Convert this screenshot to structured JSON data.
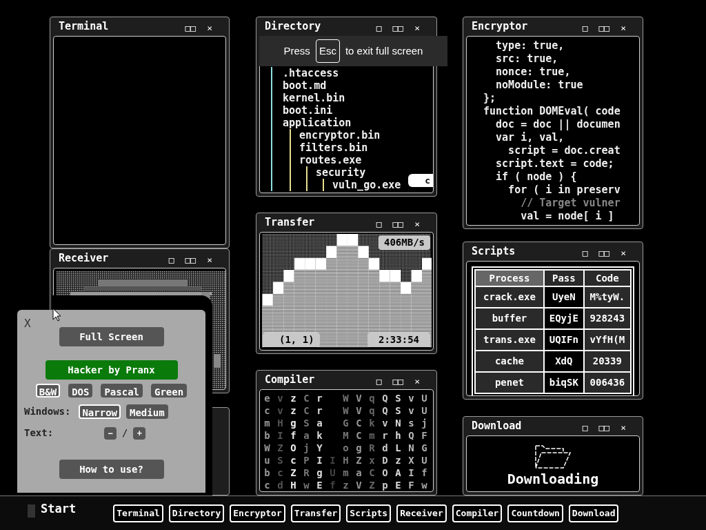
{
  "windows": [
    {
      "kind": "terminal",
      "title": "Terminal",
      "controls": [
        "□□",
        "×"
      ]
    },
    {
      "kind": "receiver",
      "title": "Receiver",
      "controls": [
        "□",
        "□□",
        "×"
      ]
    },
    {
      "kind": "directory",
      "title": "Directory",
      "controls": [
        "□",
        "□□",
        "×"
      ],
      "tree": [
        {
          "name": ".htaccess"
        },
        {
          "name": "boot.md"
        },
        {
          "name": "kernel.bin"
        },
        {
          "name": "boot.ini"
        },
        {
          "name": "application",
          "children": [
            {
              "name": "encryptor.bin"
            },
            {
              "name": "filters.bin"
            },
            {
              "name": "routes.exe",
              "children": [
                {
                  "name": "security",
                  "children": [
                    {
                      "name": "vuln_go.exe"
                    }
                  ]
                }
              ]
            }
          ]
        }
      ],
      "badge": "c"
    },
    {
      "kind": "transfer",
      "title": "Transfer",
      "controls": [
        "□",
        "□□",
        "×"
      ],
      "speed": "406MB/s",
      "position": "(1, 1)",
      "time": "2:33:54"
    },
    {
      "kind": "compiler",
      "title": "Compiler",
      "controls": [
        "□",
        "□□",
        "×"
      ],
      "columns": [
        "ecmbWubc",
        "vvHIZScd",
        "zzgfOcZH",
        "CCSajPRw",
        "rrakYIgE",
        "     IUf",
        "WWGMoHmz",
        "VVCCgZaV",
        "qqkmRxCZ",
        "QQvrdDOp",
        "SSNhLzAE",
        "vvsQNXIF",
        "UUjFGUfw"
      ]
    },
    {
      "kind": "encryptor",
      "title": "Encryptor",
      "controls": [
        "□",
        "□□",
        "×"
      ],
      "code": [
        "  type: true,",
        "  src: true,",
        "  nonce: true,",
        "  noModule: true",
        "};",
        "function DOMEval( code",
        "  doc = doc || documen",
        "  var i, val,",
        "    script = doc.creat",
        "  script.text = code;",
        "  if ( node ) {",
        "    for ( i in preserv",
        "      // Target vulner",
        "      val = node[ i ]"
      ]
    },
    {
      "kind": "scripts",
      "title": "Scripts",
      "controls": [
        "□",
        "□□",
        "×"
      ],
      "columns": [
        "Process",
        "Pass",
        "Code"
      ],
      "rows": [
        [
          "crack.exe",
          "UyeN",
          "M%tyW."
        ],
        [
          "buffer",
          "EQyjE",
          "928243"
        ],
        [
          "trans.exe",
          "UQIFn",
          "vYfH(M"
        ],
        [
          "cache",
          "XdQ",
          "20339"
        ],
        [
          "penet",
          "biqSK",
          "006436"
        ]
      ]
    },
    {
      "kind": "download",
      "title": "Download",
      "controls": [
        "□",
        "□□",
        "×"
      ],
      "status": "Downloading"
    }
  ],
  "fullscreen_notice": {
    "before": "Press",
    "key": "Esc",
    "after": "to exit full screen"
  },
  "panel": {
    "close": "X",
    "full_screen": "Full Screen",
    "brand": "Hacker by Pranx",
    "themes": [
      {
        "label": "B&W",
        "selected": true
      },
      {
        "label": "DOS",
        "selected": false
      },
      {
        "label": "Pascal",
        "selected": false
      },
      {
        "label": "Green",
        "selected": false
      }
    ],
    "windows_label": "Windows:",
    "window_sizes": [
      {
        "label": "Narrow",
        "selected": true
      },
      {
        "label": "Medium",
        "selected": false
      }
    ],
    "text_label": "Text:",
    "text_minus": "−",
    "text_sep": "/",
    "text_plus": "+",
    "help": "How to use?"
  },
  "taskbar": {
    "start": "Start",
    "items": [
      "Terminal",
      "Directory",
      "Encryptor",
      "Transfer",
      "Scripts",
      "Receiver",
      "Compiler",
      "Countdown",
      "Download"
    ]
  }
}
